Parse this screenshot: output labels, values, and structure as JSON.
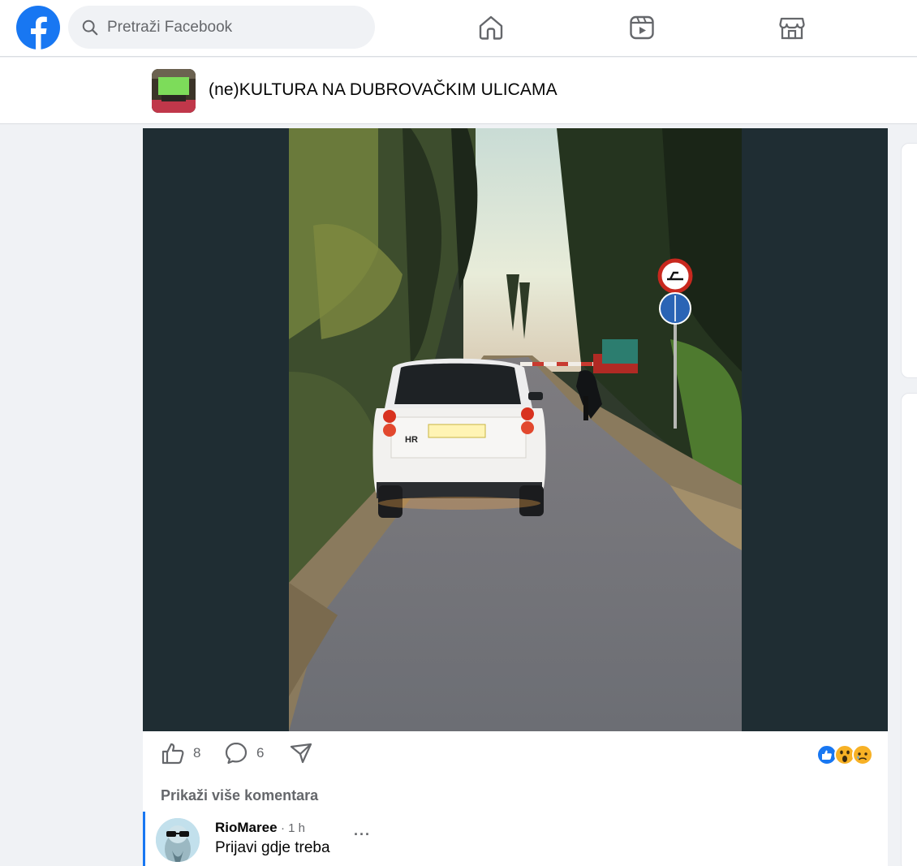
{
  "topbar": {
    "search_placeholder": "Pretraži Facebook",
    "nav_icons": [
      "home-icon",
      "reels-icon",
      "marketplace-icon"
    ]
  },
  "group": {
    "title": "(ne)KULTURA NA DUBROVAČKIM ULICAMA"
  },
  "post": {
    "photo_plate_text": "HR",
    "actions": {
      "like_count": "8",
      "comment_count": "6"
    },
    "reactions": [
      "like",
      "wow",
      "sad"
    ],
    "more_comments_label": "Prikaži više komentara"
  },
  "comment": {
    "author": "RioMaree",
    "time": "· 1 h",
    "text": "Prijavi gdje treba",
    "more": "···"
  },
  "colors": {
    "brand": "#1877f2",
    "media_bg": "#1f2d33",
    "secondary_text": "#65676b"
  }
}
